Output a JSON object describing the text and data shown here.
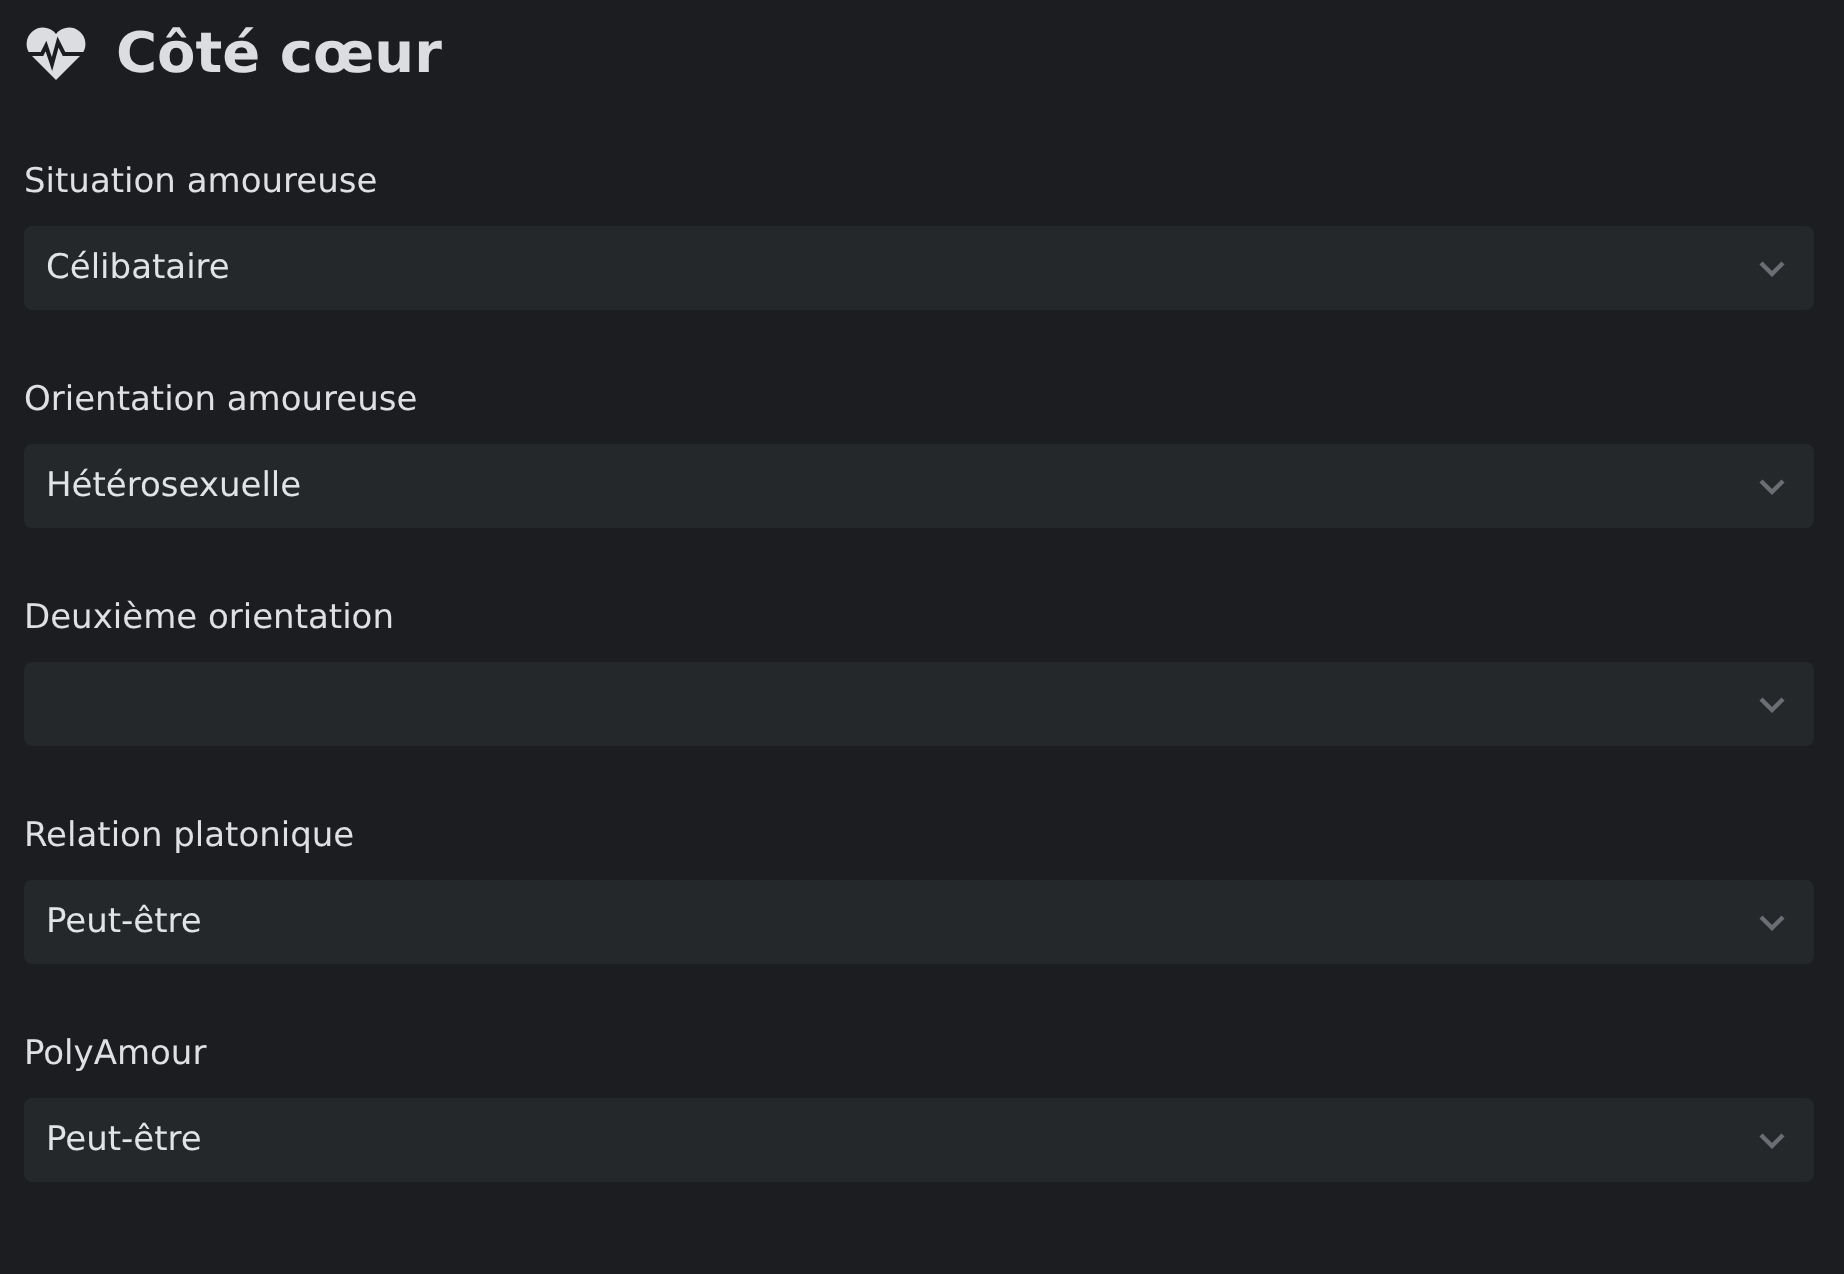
{
  "section": {
    "title": "Côté cœur"
  },
  "fields": [
    {
      "label": "Situation amoureuse",
      "value": "Célibataire"
    },
    {
      "label": "Orientation amoureuse",
      "value": "Hétérosexuelle"
    },
    {
      "label": "Deuxième orientation"
    },
    {
      "label": "Relation platonique",
      "value": "Peut-être"
    },
    {
      "label": "PolyAmour",
      "value": "Peut-être"
    }
  ]
}
